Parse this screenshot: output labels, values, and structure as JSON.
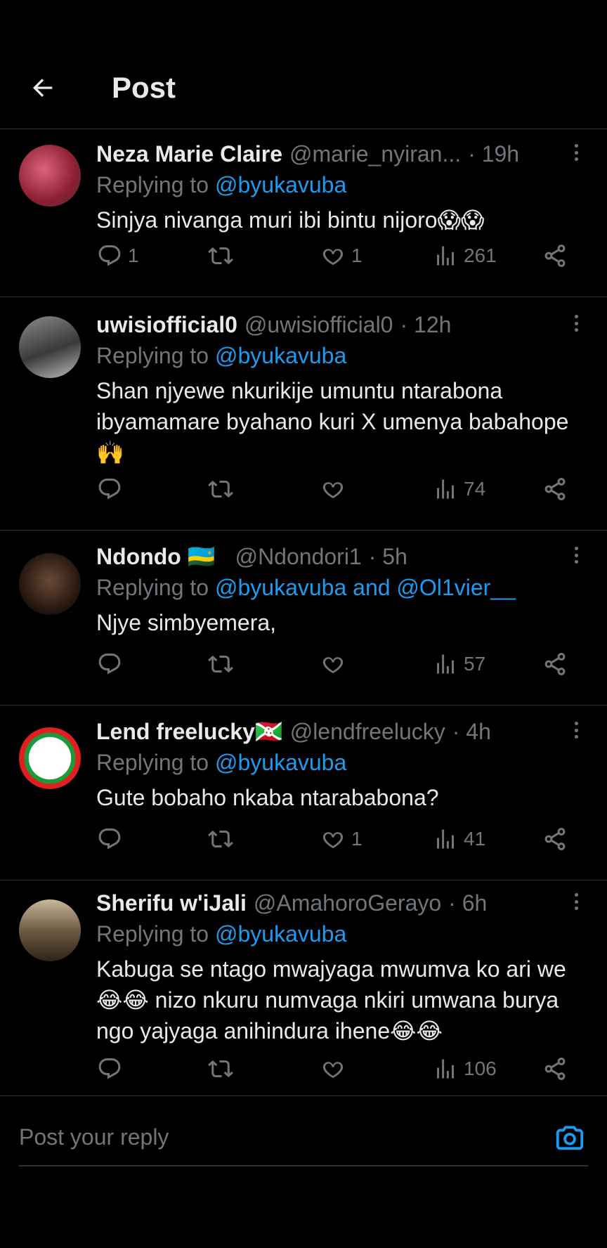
{
  "header": {
    "title": "Post"
  },
  "reply_prefix": "Replying to ",
  "posts": [
    {
      "name": "Neza Marie Claire",
      "handle": "@marie_nyiran...",
      "time": "· 19h",
      "replying_to": "@byukavuba",
      "text": "Sinjya nivanga muri ibi bintu nijoro😱😱",
      "replies": "1",
      "reposts": "",
      "likes": "1",
      "views": "261"
    },
    {
      "name": "uwisiofficial0",
      "handle": "@uwisiofficial0",
      "time": "· 12h",
      "replying_to": "@byukavuba",
      "text": "Shan njyewe nkurikije umuntu ntarabona ibyamamare byahano kuri X umenya babahope 🙌",
      "replies": "",
      "reposts": "",
      "likes": "",
      "views": "74"
    },
    {
      "name": "Ndondo 🇷🇼",
      "handle": "@Ndondori1",
      "time": "· 5h",
      "replying_to": "@byukavuba and @Ol1vier__",
      "text": "Njye simbyemera,",
      "replies": "",
      "reposts": "",
      "likes": "",
      "views": "57"
    },
    {
      "name": "Lend freelucky🇧🇮",
      "handle": "@lendfreelucky",
      "time": "· 4h",
      "replying_to": "@byukavuba",
      "text": "Gute bobaho nkaba ntarababona?",
      "replies": "",
      "reposts": "",
      "likes": "1",
      "views": "41"
    },
    {
      "name": "Sherifu w'iJali",
      "handle": "@AmahoroGerayo",
      "time": "· 6h",
      "replying_to": "@byukavuba",
      "text": "Kabuga se ntago mwajyaga mwumva ko ari we 😂😂 nizo nkuru numvaga nkiri umwana burya ngo yajyaga anihindura ihene😂😂",
      "replies": "",
      "reposts": "",
      "likes": "",
      "views": "106"
    }
  ],
  "compose": {
    "placeholder": "Post your reply"
  },
  "colors": {
    "accent": "#1d9bf0",
    "muted": "#71767b",
    "text": "#e7e9ea",
    "divider": "#2f3336",
    "background": "#000000"
  },
  "icons": [
    "back-arrow-icon",
    "more-icon",
    "reply-icon",
    "repost-icon",
    "like-icon",
    "views-icon",
    "share-icon",
    "camera-icon"
  ]
}
